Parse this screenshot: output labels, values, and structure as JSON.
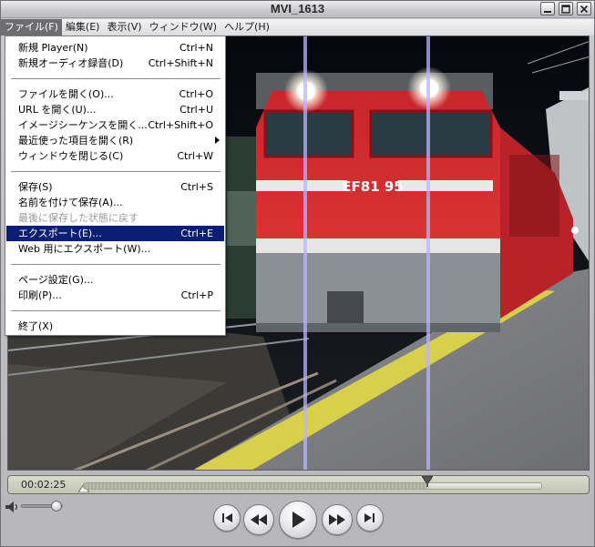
{
  "window": {
    "title": "MVI_1613"
  },
  "menubar": {
    "items": [
      {
        "label": "ファイル(F)"
      },
      {
        "label": "編集(E)"
      },
      {
        "label": "表示(V)"
      },
      {
        "label": "ウィンドウ(W)"
      },
      {
        "label": "ヘルプ(H)"
      }
    ]
  },
  "file_menu": {
    "new_player": {
      "label": "新規 Player(N)",
      "shortcut": "Ctrl+N"
    },
    "new_audio": {
      "label": "新規オーディオ録音(D)",
      "shortcut": "Ctrl+Shift+N"
    },
    "open_file": {
      "label": "ファイルを開く(O)...",
      "shortcut": "Ctrl+O"
    },
    "open_url": {
      "label": "URL を開く(U)...",
      "shortcut": "Ctrl+U"
    },
    "open_image_seq": {
      "label": "イメージシーケンスを開く...",
      "shortcut": "Ctrl+Shift+O"
    },
    "open_recent": {
      "label": "最近使った項目を開く(R)"
    },
    "close_window": {
      "label": "ウィンドウを閉じる(C)",
      "shortcut": "Ctrl+W"
    },
    "save": {
      "label": "保存(S)",
      "shortcut": "Ctrl+S"
    },
    "save_as": {
      "label": "名前を付けて保存(A)..."
    },
    "revert": {
      "label": "最後に保存した状態に戻す"
    },
    "export": {
      "label": "エクスポート(E)...",
      "shortcut": "Ctrl+E"
    },
    "export_web": {
      "label": "Web 用にエクスポート(W)..."
    },
    "page_setup": {
      "label": "ページ設定(G)..."
    },
    "print": {
      "label": "印刷(P)...",
      "shortcut": "Ctrl+P"
    },
    "exit": {
      "label": "終了(X)"
    }
  },
  "video": {
    "locomotive_number": "EF81 95"
  },
  "timeline": {
    "current_time": "00:02:25",
    "playhead_fraction": 0.75
  },
  "volume": {
    "level": 0.8
  },
  "controls": {
    "icons": [
      "go-to-start-icon",
      "rewind-icon",
      "play-icon",
      "fast-forward-icon",
      "go-to-end-icon"
    ]
  },
  "colors": {
    "menu_highlight": "#0a1f74",
    "locomotive_red": "#d8232a",
    "platform_yellow": "#d8d04a"
  }
}
